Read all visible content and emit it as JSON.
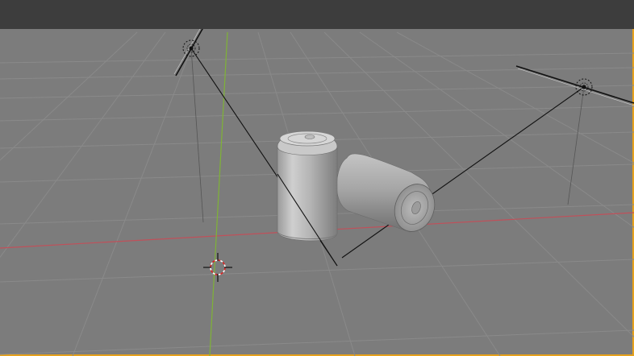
{
  "app": "3D Viewport",
  "colors": {
    "header": "#3d3d3d",
    "viewport_bg": "#7c7c7c",
    "grid_line": "#8a8a8a",
    "x_axis": "#c0505a",
    "y_axis": "#7fb336",
    "active_border": "#e6a11c",
    "can_light": "#c8c8c8",
    "can_dark": "#7a7a7a"
  },
  "scene": {
    "objects": [
      {
        "name": "light-left",
        "type": "light"
      },
      {
        "name": "light-right",
        "type": "light"
      },
      {
        "name": "can-standing",
        "type": "mesh"
      },
      {
        "name": "can-lying",
        "type": "mesh"
      },
      {
        "name": "3d-cursor",
        "type": "cursor"
      }
    ]
  }
}
